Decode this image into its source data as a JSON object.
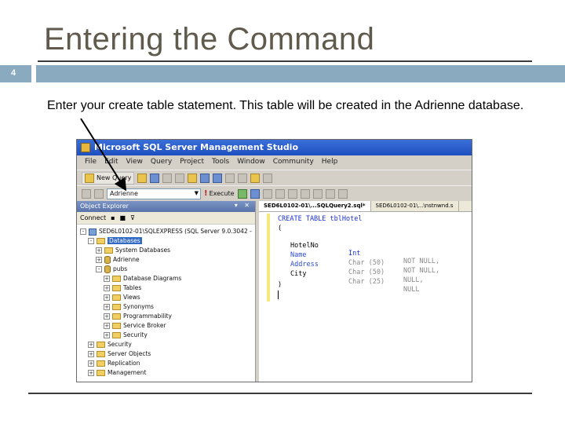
{
  "slide": {
    "title": "Entering the Command",
    "number": "4",
    "body": "Enter your create table statement.  This table will be created in the Adrienne database."
  },
  "colors": {
    "accent_bar": "#8aaac0",
    "title": "#5f5a4c"
  },
  "ssms": {
    "title": "Microsoft SQL Server Management Studio",
    "menu": [
      "File",
      "Edit",
      "View",
      "Query",
      "Project",
      "Tools",
      "Window",
      "Community",
      "Help"
    ],
    "new_query_label": "New Query",
    "database_selected": "Adrienne",
    "execute_label": "Execute",
    "object_explorer": {
      "title": "Object Explorer",
      "connect_label": "Connect",
      "tree": [
        {
          "label": "SED6L0102-01\\SQLEXPRESS (SQL Server 9.0.3042 -",
          "icon": "server-icon",
          "expander": "-"
        },
        {
          "label": "Databases",
          "icon": "folder-icon",
          "expander": "-",
          "selected": true
        },
        {
          "label": "System Databases",
          "icon": "folder-icon",
          "expander": "+"
        },
        {
          "label": "Adrienne",
          "icon": "database-icon",
          "expander": "+"
        },
        {
          "label": "pubs",
          "icon": "database-icon",
          "expander": "-"
        },
        {
          "label": "Database Diagrams",
          "icon": "folder-icon",
          "expander": "+"
        },
        {
          "label": "Tables",
          "icon": "folder-icon",
          "expander": "+"
        },
        {
          "label": "Views",
          "icon": "folder-icon",
          "expander": "+"
        },
        {
          "label": "Synonyms",
          "icon": "folder-icon",
          "expander": "+"
        },
        {
          "label": "Programmability",
          "icon": "folder-icon",
          "expander": "+"
        },
        {
          "label": "Service Broker",
          "icon": "folder-icon",
          "expander": "+"
        },
        {
          "label": "Security",
          "icon": "folder-icon",
          "expander": "+"
        },
        {
          "label": "Security",
          "icon": "folder-icon",
          "expander": "+"
        },
        {
          "label": "Server Objects",
          "icon": "folder-icon",
          "expander": "+"
        },
        {
          "label": "Replication",
          "icon": "folder-icon",
          "expander": "+"
        },
        {
          "label": "Management",
          "icon": "folder-icon",
          "expander": "+"
        }
      ]
    },
    "tabs": [
      "SED6L0102-01\\...SQLQuery2.sql*",
      "SED6L0102-01\\...\\nstnwnd.s"
    ],
    "code": {
      "line1": "CREATE TABLE tblHotel",
      "open_paren": "(",
      "rows": [
        {
          "name": "HotelNo",
          "type": "Int",
          "constraint": "NOT NULL,"
        },
        {
          "name": "Name",
          "type": "Char (50)",
          "constraint": "NOT NULL,"
        },
        {
          "name": "Address",
          "type": "Char (50)",
          "constraint": "NULL,"
        },
        {
          "name": "City",
          "type": "Char (25)",
          "constraint": "NULL"
        }
      ],
      "close_paren": ")"
    }
  }
}
